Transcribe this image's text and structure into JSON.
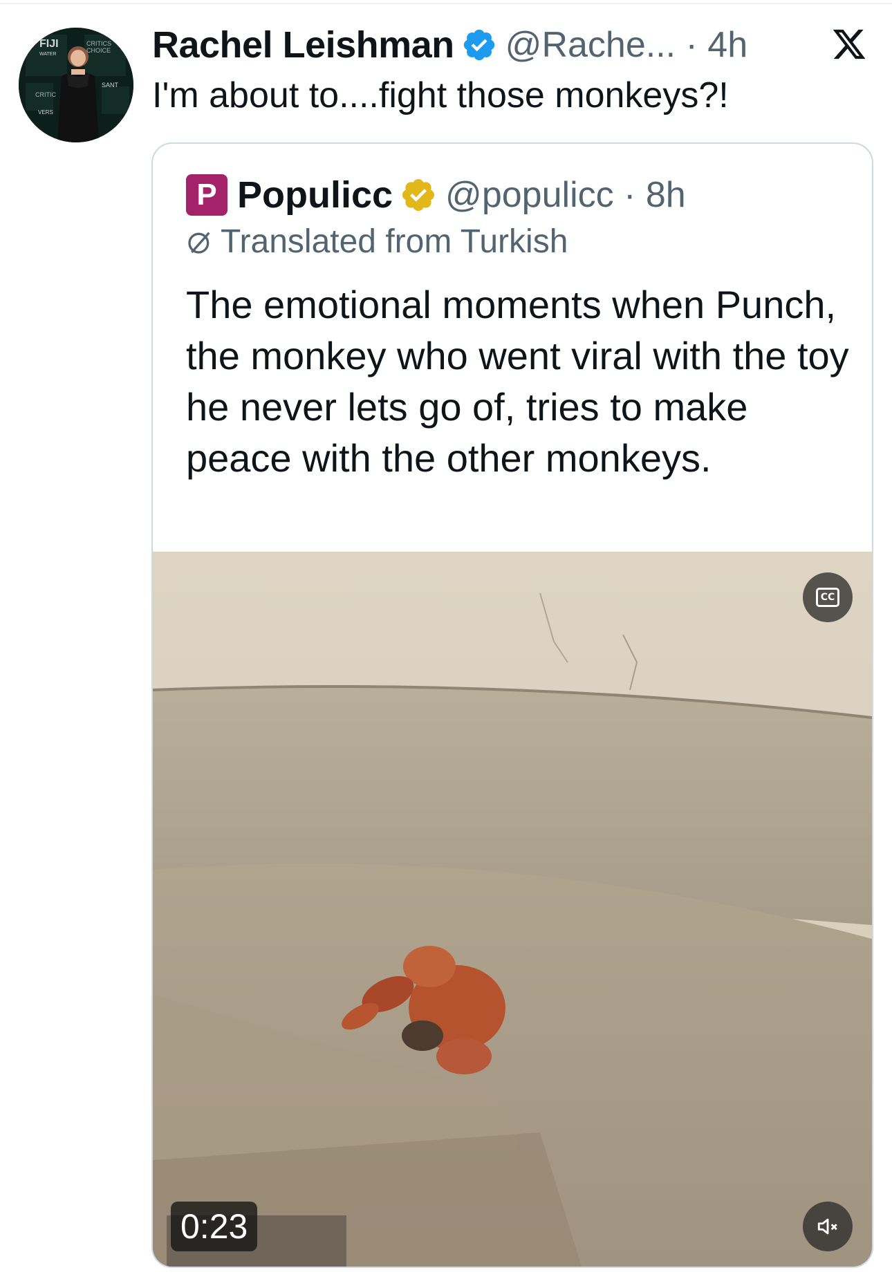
{
  "tweet": {
    "author": {
      "display_name": "Rachel Leishman",
      "handle_time": "@Rache... · 4h",
      "avatar_icon": "profile-photo",
      "verified": true
    },
    "text": "I'm about to....fight those monkeys?!"
  },
  "quote": {
    "logo_letter": "P",
    "display_name": "Populicc",
    "handle_time": "@populicc · 8h",
    "translated_label": "Translated from Turkish",
    "text": "The emotional moments when Punch, the monkey who went viral with the toy he never lets go of, tries to make peace with the other monkeys.",
    "video": {
      "duration": "0:23",
      "cc_label": "CC"
    }
  },
  "colors": {
    "text_primary": "#0f1419",
    "text_secondary": "#536471",
    "verified_blue": "#1d9bf0",
    "verified_gold": "#e2b719",
    "populicc_brand": "#a3226a",
    "border": "#cfd9de"
  },
  "icons": {
    "verified": "verified-badge-icon",
    "gold_verified": "gold-verified-badge-icon",
    "platform": "x-logo-icon",
    "translate": "translate-icon",
    "captions": "closed-captions-icon",
    "mute": "speaker-muted-icon"
  }
}
